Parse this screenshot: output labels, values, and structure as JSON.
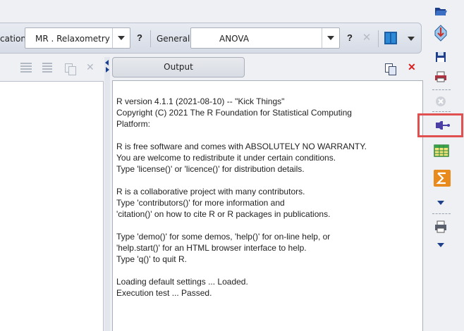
{
  "toolbar": {
    "location_label": "cation",
    "location_value": "MR . Relaxometry",
    "general_label": "General",
    "general_value": "ANOVA",
    "help_label": "?",
    "close_label": "✕"
  },
  "left_panel": {
    "close_label": "✕"
  },
  "output_panel": {
    "tab_label": "Output",
    "close_label": "✕",
    "console_lines": [
      "R version 4.1.1 (2021-08-10) -- \"Kick Things\"",
      "Copyright (C) 2021 The R Foundation for Statistical Computing",
      "Platform:",
      "",
      "R is free software and comes with ABSOLUTELY NO WARRANTY.",
      "You are welcome to redistribute it under certain conditions.",
      "Type 'license()' or 'licence()' for distribution details.",
      "",
      "R is a collaborative project with many contributors.",
      "Type 'contributors()' for more information and",
      "'citation()' on how to cite R or R packages in publications.",
      "",
      "Type 'demo()' for some demos, 'help()' for on-line help, or",
      "'help.start()' for an HTML browser interface to help.",
      "Type 'q()' to quit R.",
      "",
      "Loading default settings ... Loaded.",
      "Execution test ... Passed."
    ]
  },
  "right_toolbar": {
    "icons": [
      "open-folder-icon",
      "import-icon",
      "save-icon",
      "print-icon",
      "cancel-icon",
      "r-connect-icon",
      "table-icon",
      "sum-icon",
      "more-caret-icon",
      "print-preview-icon",
      "more-caret-icon"
    ],
    "highlighted": "r-connect-icon"
  },
  "colors": {
    "highlight": "#e05050",
    "accent": "#1e3f8a",
    "close_red": "#d81f1f"
  }
}
